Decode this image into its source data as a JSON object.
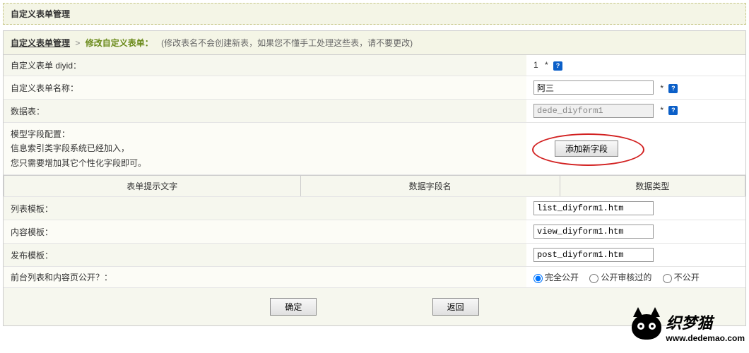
{
  "header": {
    "title": "自定义表单管理"
  },
  "breadcrumb": {
    "link": "自定义表单管理",
    "sep": ">",
    "current": "修改自定义表单：",
    "hint": "(修改表名不会创建新表，如果您不懂手工处理这些表，请不要更改)"
  },
  "rows": {
    "diyid": {
      "label": "自定义表单 diyid：",
      "value": "1",
      "req": "*"
    },
    "name": {
      "label": "自定义表单名称：",
      "value": "阿三",
      "req": "*"
    },
    "table": {
      "label": "数据表：",
      "value": "dede_diyform1",
      "req": "*"
    },
    "config": {
      "label": "模型字段配置：",
      "desc1": "信息索引类字段系统已经加入，",
      "desc2": "您只需要增加其它个性化字段即可。",
      "btn": "添加新字段"
    },
    "listtpl": {
      "label": "列表模板：",
      "value": "list_diyform1.htm"
    },
    "viewtpl": {
      "label": "内容模板：",
      "value": "view_diyform1.htm"
    },
    "posttpl": {
      "label": "发布模板：",
      "value": "post_diyform1.htm"
    },
    "public": {
      "label": "前台列表和内容页公开？：",
      "opts": [
        "完全公开",
        "公开审核过的",
        "不公开"
      ],
      "selected": 0
    }
  },
  "fieldHeader": {
    "col1": "表单提示文字",
    "col2": "数据字段名",
    "col3": "数据类型"
  },
  "buttons": {
    "ok": "确定",
    "back": "返回"
  },
  "watermark": {
    "name": "织梦猫",
    "url": "www.dedemao.com"
  },
  "help": "?"
}
